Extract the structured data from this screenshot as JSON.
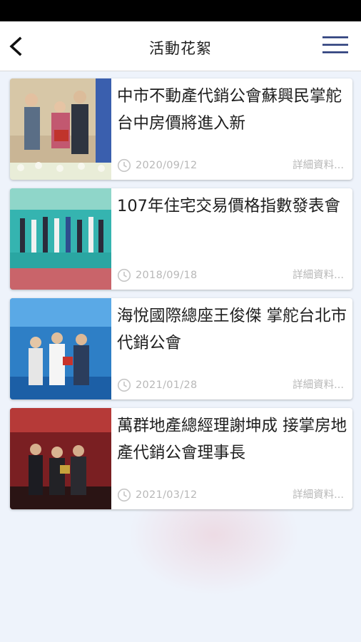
{
  "header": {
    "title": "活動花絮",
    "back_icon": "chevron-left-icon",
    "menu_icon": "hamburger-menu-icon",
    "menu_icon_color": "#2a3c7a"
  },
  "news": [
    {
      "title": "中市不動產代銷公會蘇興民掌舵 台中房價將進入新",
      "date": "2020/09/12",
      "more": "詳細資料..."
    },
    {
      "title": "107年住宅交易價格指數發表會",
      "date": "2018/09/18",
      "more": "詳細資料..."
    },
    {
      "title": "海悅國際總座王俊傑 掌舵台北市代銷公會",
      "date": "2021/01/28",
      "more": "詳細資料..."
    },
    {
      "title": "萬群地產總經理謝坤成 接掌房地產代銷公會理事長",
      "date": "2021/03/12",
      "more": "詳細資料..."
    }
  ]
}
